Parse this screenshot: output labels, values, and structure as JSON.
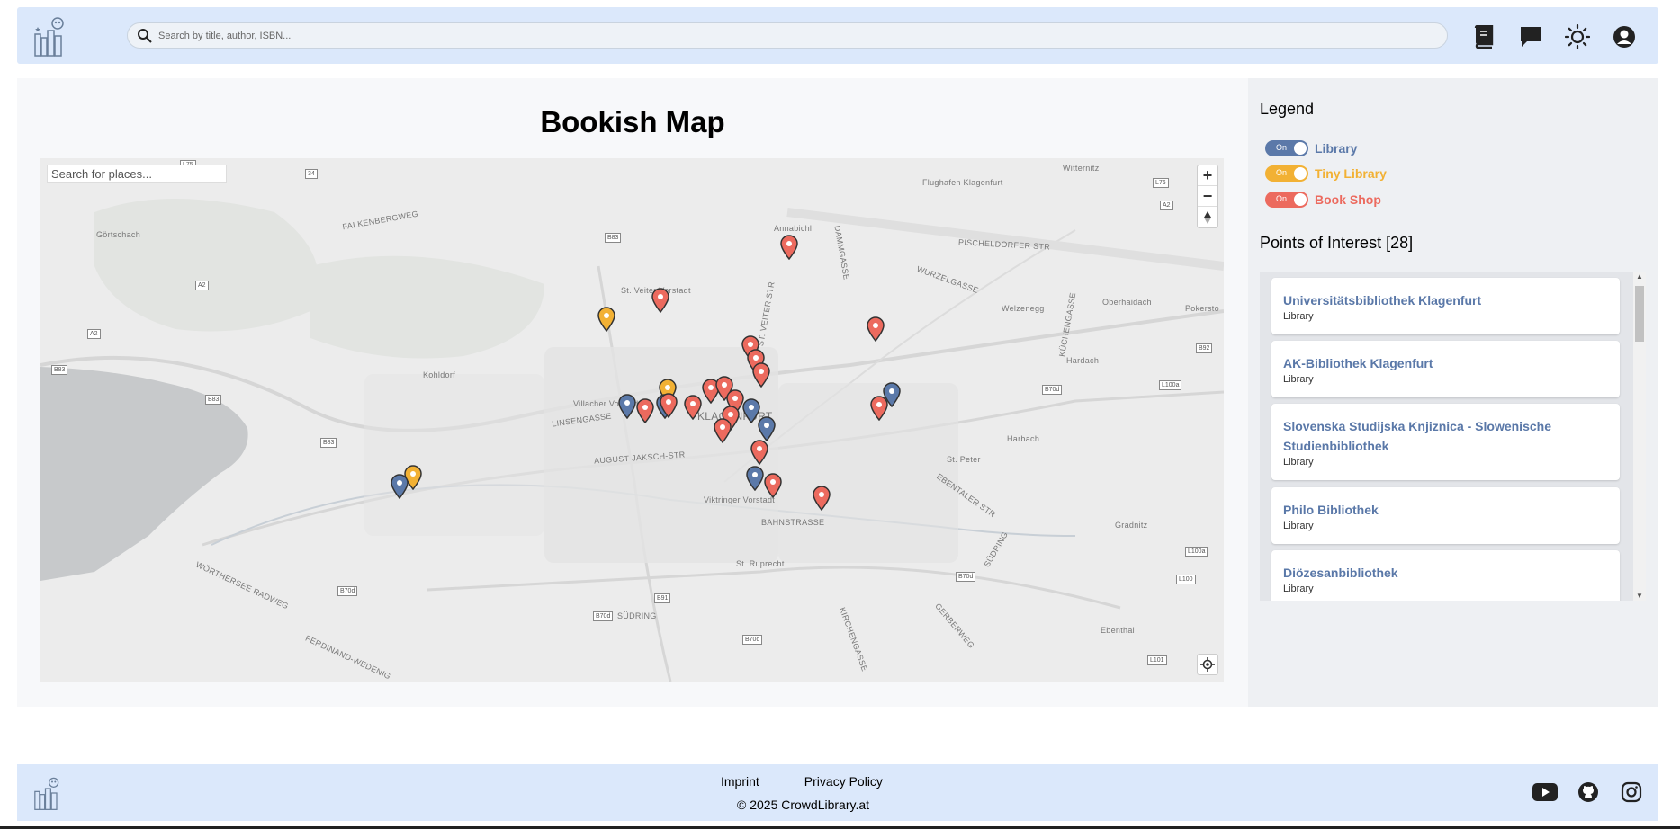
{
  "header": {
    "search_placeholder": "Search by title, author, ISBN...",
    "icons": [
      "book-icon",
      "chat-icon",
      "theme-toggle-icon",
      "account-icon"
    ]
  },
  "map": {
    "title": "Bookish Map",
    "place_search_placeholder": "Search for places...",
    "zoom_in": "+",
    "zoom_out": "−",
    "labels": {
      "flughafen": "Flughafen Klagenfurt",
      "witternitz": "Witternitz",
      "gortschach": "Görtschach",
      "falkenberg": "FALKENBERGWEG",
      "annabichl": "Annabichl",
      "pischeldorfer": "PISCHELDORFER STR",
      "st_veiter_vorstadt": "St. Veiter Vorstadt",
      "st_veiter_str": "ST. VEITER STR",
      "wurzelgasse": "WURZELGASSE",
      "welzenegg": "Welzenegg",
      "oberhaidach": "Oberhaidach",
      "hardach": "Hardach",
      "kohldorf": "Kohldorf",
      "villacher": "Villacher Vorstadt",
      "linsengasse": "LINSENGASSE",
      "klagenfurt": "KLAGENFURT",
      "august_jaksch": "AUGUST-JAKSCH-STR",
      "harbach": "Harbach",
      "st_peter": "St. Peter",
      "ebentaler": "EBENTALER STR",
      "viktringer": "Viktringer Vorstadt",
      "bahnstrasse": "BAHNSTRASSE",
      "gradnitz": "Gradnitz",
      "st_ruprecht": "St. Ruprecht",
      "suedring": "SÜDRING",
      "woerthersee": "WÖRTHERSEE RADWEG",
      "ferdinand": "FERDINAND-WEDENIG",
      "kirchengasse": "KIRCHENGASSE",
      "gerberweg": "GERBERWEG",
      "ebenthal": "Ebenthal",
      "suedring2": "SÜDRING",
      "kuechengasse": "KÜCHENGASSE",
      "damgasse": "DAMMGASSE",
      "pokersdorf": "Pokersto"
    },
    "roads": [
      "L75",
      "34",
      "A2",
      "A2",
      "B83",
      "B83",
      "B83",
      "B83",
      "L76",
      "A2",
      "B92",
      "L100a",
      "B70d",
      "B70d",
      "B70d",
      "B70d",
      "B91",
      "B70d",
      "L100a",
      "L100",
      "L101"
    ]
  },
  "legend": {
    "title": "Legend",
    "toggle_text": "On",
    "items": [
      {
        "label": "Library",
        "color": "#5b79a9"
      },
      {
        "label": "Tiny Library",
        "color": "#f2b134"
      },
      {
        "label": "Book Shop",
        "color": "#ec6a5e"
      }
    ]
  },
  "poi": {
    "title": "Points of Interest [28]",
    "items": [
      {
        "name": "Universitätsbibliothek Klagenfurt",
        "type": "Library"
      },
      {
        "name": "AK-Bibliothek Klagenfurt",
        "type": "Library"
      },
      {
        "name": "Slovenska Studijska Knjiznica - Slowenische Studienbibliothek",
        "type": "Library"
      },
      {
        "name": "Philo Bibliothek",
        "type": "Library"
      },
      {
        "name": "Diözesanbibliothek",
        "type": "Library"
      }
    ]
  },
  "footer": {
    "imprint": "Imprint",
    "privacy": "Privacy Policy",
    "copyright": "© 2025 CrowdLibrary.at",
    "social_icons": [
      "youtube-icon",
      "github-icon",
      "instagram-icon"
    ]
  }
}
